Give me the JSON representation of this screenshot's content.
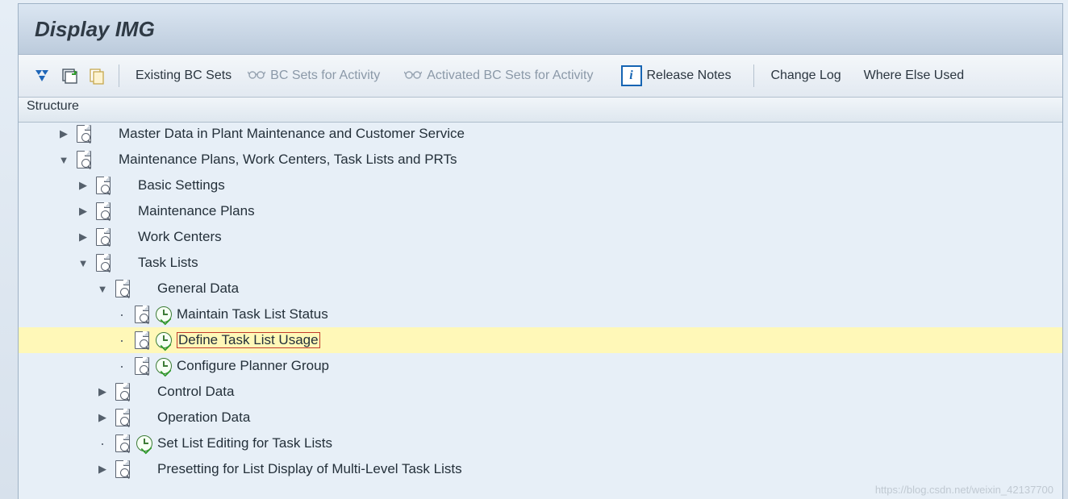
{
  "title": "Display IMG",
  "toolbar": {
    "existing_bc_sets": "Existing BC Sets",
    "bc_sets_activity": "BC Sets for Activity",
    "activated_bc_sets": "Activated BC Sets for Activity",
    "release_notes": "Release Notes",
    "change_log": "Change Log",
    "where_else_used": "Where Else Used"
  },
  "structure_header": "Structure",
  "tree": {
    "n0": "Master Data in Plant Maintenance and Customer Service",
    "n1": "Maintenance Plans, Work Centers, Task Lists and PRTs",
    "n1_0": "Basic Settings",
    "n1_1": "Maintenance Plans",
    "n1_2": "Work Centers",
    "n1_3": "Task Lists",
    "n1_3_0": "General Data",
    "n1_3_0_0": "Maintain Task List Status",
    "n1_3_0_1": "Define Task List Usage",
    "n1_3_0_2": "Configure Planner Group",
    "n1_3_1": "Control Data",
    "n1_3_2": "Operation Data",
    "n1_3_3": "Set List Editing for Task Lists",
    "n1_3_4": "Presetting for List Display of Multi-Level Task Lists"
  },
  "watermark": "https://blog.csdn.net/weixin_42137700"
}
